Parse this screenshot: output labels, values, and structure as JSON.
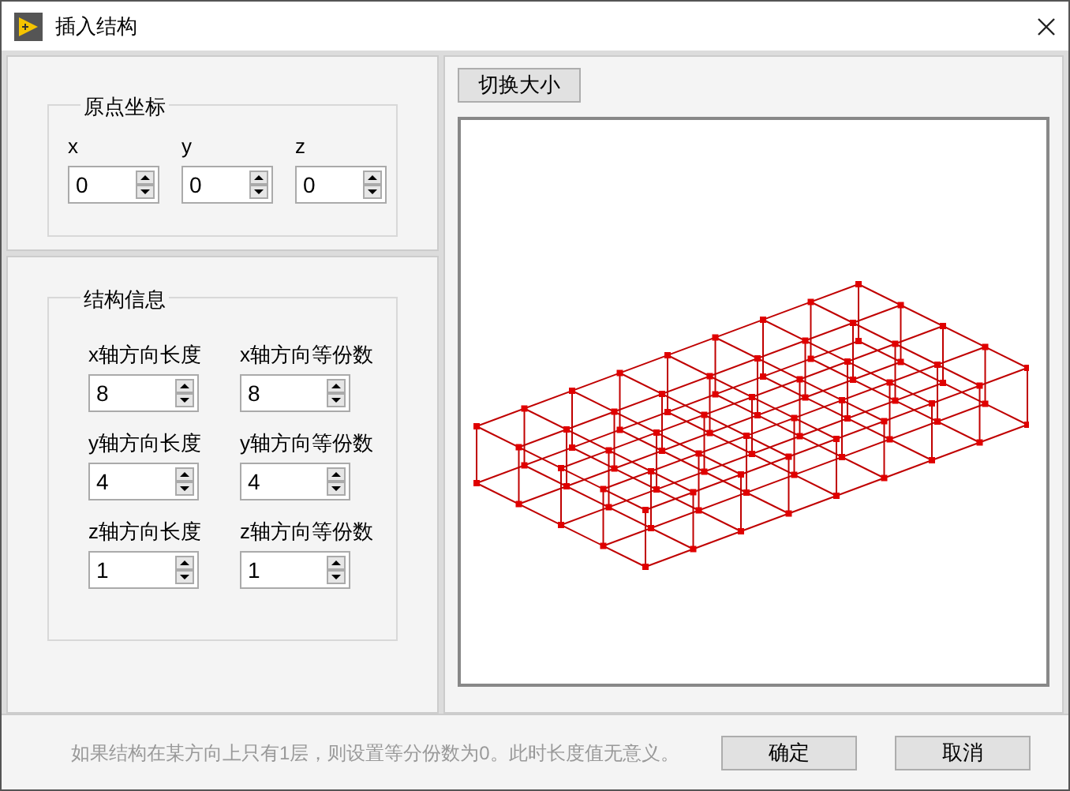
{
  "window": {
    "title": "插入结构"
  },
  "origin": {
    "title": "原点坐标",
    "fields": [
      {
        "label": "x",
        "value": "0"
      },
      {
        "label": "y",
        "value": "0"
      },
      {
        "label": "z",
        "value": "0"
      }
    ]
  },
  "structure": {
    "title": "结构信息",
    "fields": [
      {
        "label": "x轴方向长度",
        "value": "8"
      },
      {
        "label": "x轴方向等份数",
        "value": "8"
      },
      {
        "label": "y轴方向长度",
        "value": "4"
      },
      {
        "label": "y轴方向等份数",
        "value": "4"
      },
      {
        "label": "z轴方向长度",
        "value": "1"
      },
      {
        "label": "z轴方向等份数",
        "value": "1"
      }
    ]
  },
  "preview": {
    "toggle_button": "切换大小"
  },
  "footer": {
    "hint": "如果结构在某方向上只有1层，则设置等分份数为0。此时长度值无意义。",
    "buttons": [
      "确定",
      "取消"
    ]
  }
}
